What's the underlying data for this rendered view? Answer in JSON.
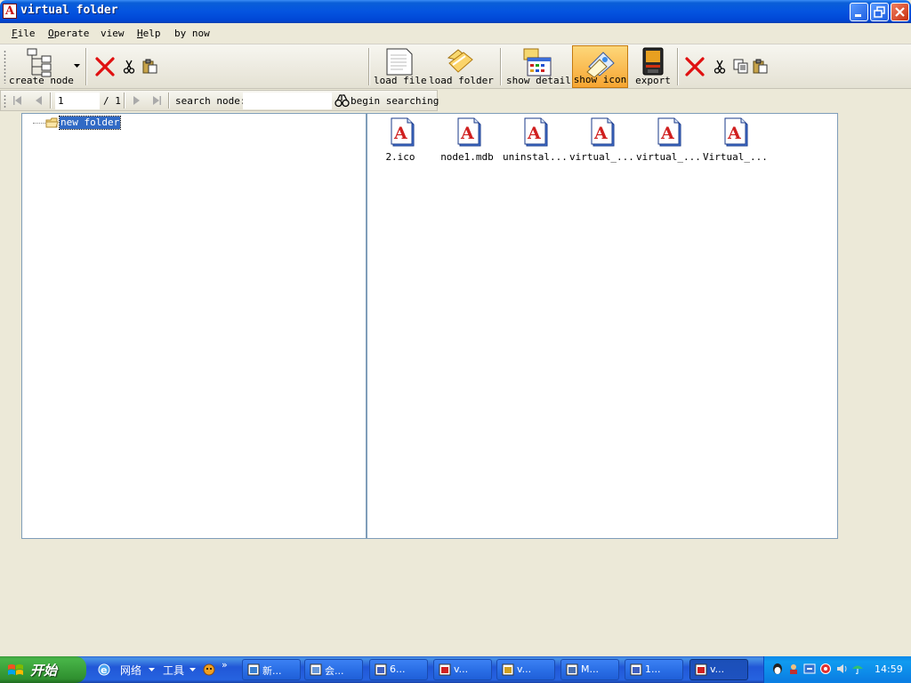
{
  "window": {
    "title": "virtual folder",
    "app_icon_letter": "A"
  },
  "menu": [
    {
      "label": "File",
      "accel": "F",
      "rest": "ile"
    },
    {
      "label": "Operate",
      "accel": "O",
      "rest": "perate"
    },
    {
      "label": "view",
      "accel": "",
      "rest": "view"
    },
    {
      "label": "Help",
      "accel": "H",
      "rest": "elp"
    },
    {
      "label": "by now",
      "accel": "",
      "rest": "by now"
    }
  ],
  "toolbar": {
    "create_node": "create node",
    "load_file": "load file",
    "load_folder": "load folder",
    "show_detail": "show detail",
    "show_icon": "show icon",
    "export": "export"
  },
  "navigator": {
    "page_value": "1",
    "page_total": "/ 1",
    "search_label": "search node:",
    "search_value": "",
    "search_button": "begin searching"
  },
  "tree": {
    "root_label": "new folder"
  },
  "files": [
    {
      "name": "2.ico"
    },
    {
      "name": "node1.mdb"
    },
    {
      "name": "uninstal..."
    },
    {
      "name": "virtual_..."
    },
    {
      "name": "virtual_..."
    },
    {
      "name": "Virtual_..."
    }
  ],
  "file_icon_letter": "A",
  "taskbar": {
    "start_label": "开始",
    "network_label": "网络",
    "tools_label": "工具",
    "more_label": "»",
    "tasks": [
      {
        "label": "新..."
      },
      {
        "label": "会..."
      },
      {
        "label": "6..."
      },
      {
        "label": "v..."
      },
      {
        "label": "v..."
      },
      {
        "label": "M..."
      },
      {
        "label": "1..."
      },
      {
        "label": "v..."
      }
    ],
    "clock": "14:59"
  },
  "colors": {
    "accent": "#0454e0",
    "selection": "#316ac5",
    "file_icon_red": "#d02020",
    "taskbar": "#2157d7"
  }
}
